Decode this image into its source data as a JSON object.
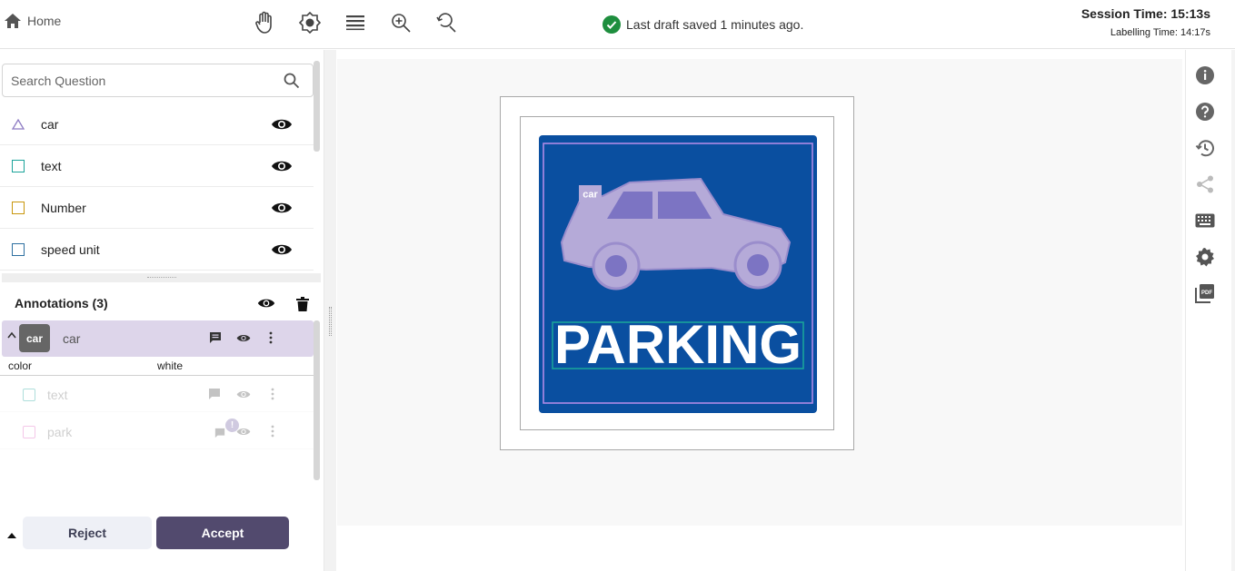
{
  "header": {
    "home_label": "Home",
    "tools": [
      "pan-hand-icon",
      "brightness-icon",
      "layers-icon",
      "zoom-in-icon",
      "zoom-reset-icon"
    ],
    "save_status": "Last draft saved 1 minutes ago.",
    "session_time": "Session Time: 15:13s",
    "labelling_time": "Labelling Time: 14:17s"
  },
  "search": {
    "placeholder": "Search Question"
  },
  "questions": [
    {
      "label": "car",
      "shape": "triangle",
      "color": "#8e7cc3"
    },
    {
      "label": "text",
      "shape": "square",
      "color": "#1aa39a"
    },
    {
      "label": "Number",
      "shape": "square",
      "color": "#c8960c"
    },
    {
      "label": "speed unit",
      "shape": "square",
      "color": "#2d6fa0"
    }
  ],
  "annotations": {
    "title": "Annotations (3)",
    "selected": {
      "badge": "car",
      "label": "car"
    },
    "attribute": {
      "name": "color",
      "value": "white"
    },
    "others": [
      {
        "label": "text",
        "color": "#1aa39a",
        "notification": ""
      },
      {
        "label": "park",
        "color": "#e060c0",
        "notification": "!"
      }
    ]
  },
  "actions": {
    "reject": "Reject",
    "accept": "Accept"
  },
  "image": {
    "car_tag": "car",
    "sign_text": "PARKING",
    "colors": {
      "sign_bg": "#0a4fa0",
      "car_fill": "#b5aad8",
      "car_box": "#8a6fd8",
      "text_box": "#1aa39a"
    }
  },
  "right_tools": [
    "info-icon",
    "help-icon",
    "history-icon",
    "share-icon",
    "keyboard-icon",
    "settings-icon",
    "pdf-icon"
  ]
}
